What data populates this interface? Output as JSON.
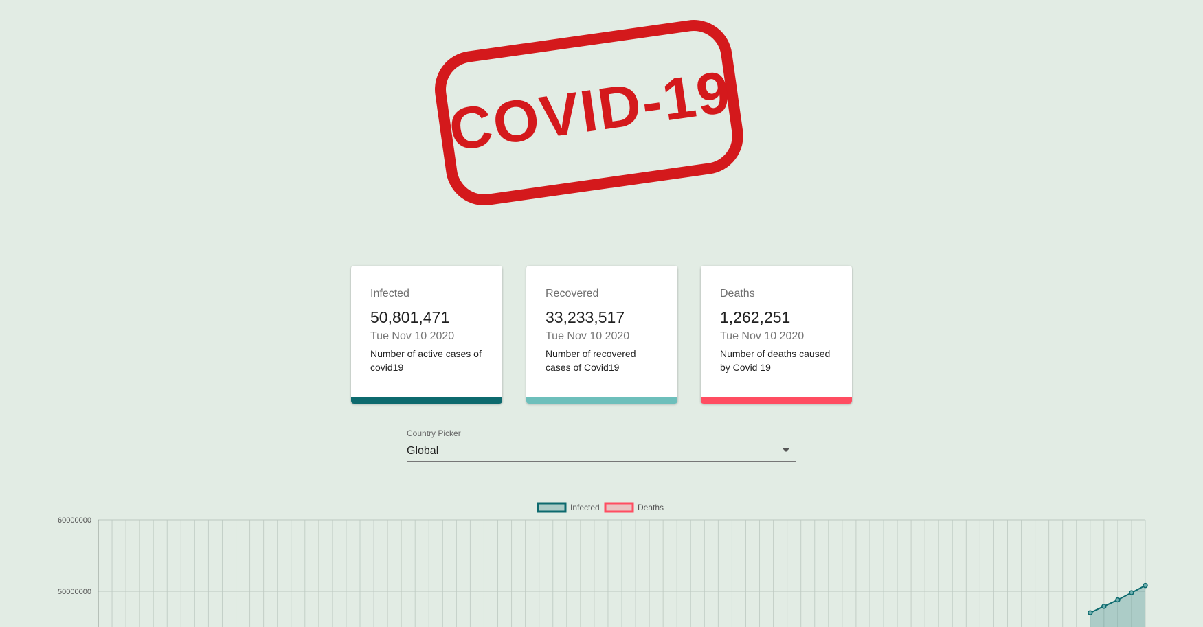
{
  "logo": {
    "text": "COVID-19",
    "color": "#d4191c"
  },
  "cards": [
    {
      "title": "Infected",
      "value": "50,801,471",
      "date": "Tue Nov 10 2020",
      "description": "Number of active cases of covid19",
      "color": "#0d6a6e"
    },
    {
      "title": "Recovered",
      "value": "33,233,517",
      "date": "Tue Nov 10 2020",
      "description": "Number of recovered cases of Covid19",
      "color": "#6dbfbb"
    },
    {
      "title": "Deaths",
      "value": "1,262,251",
      "date": "Tue Nov 10 2020",
      "description": "Number of deaths caused by Covid 19",
      "color": "#ff4d61"
    }
  ],
  "country_picker": {
    "label": "Country Picker",
    "value": "Global"
  },
  "chart_data": {
    "type": "line",
    "series": [
      {
        "name": "Infected",
        "color": "#0d6a6e",
        "fill": "rgba(13,106,110,0.25)",
        "x": [
          -4,
          -3,
          -2,
          -1,
          0
        ],
        "values": [
          47000000,
          47900000,
          48800000,
          49800000,
          50801471
        ]
      },
      {
        "name": "Deaths",
        "color": "#ff4d61",
        "fill": "rgba(255,77,97,0.25)",
        "values": []
      }
    ],
    "yticks": [
      "60000000",
      "50000000"
    ],
    "ylim": [
      45000000,
      60000000
    ],
    "grid": true,
    "legend": "top-center",
    "xcount": 77
  }
}
